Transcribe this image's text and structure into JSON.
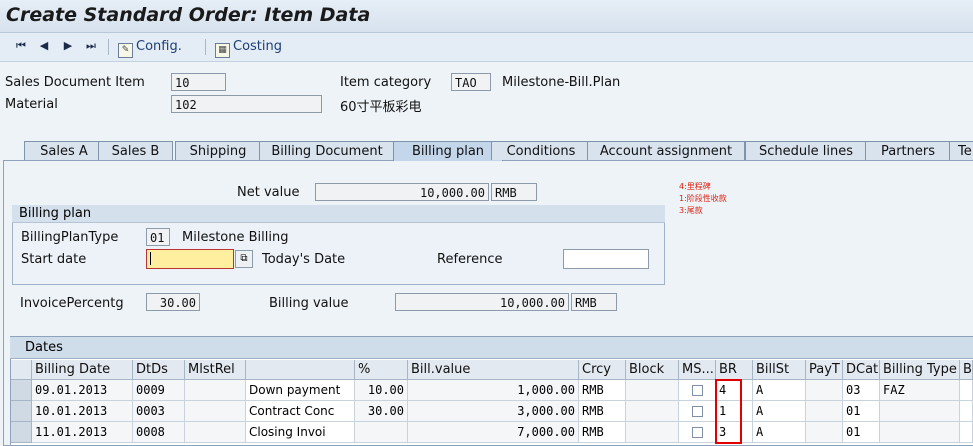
{
  "window": {
    "title": "Create Standard Order: Item Data"
  },
  "toolbar": {
    "config_label": "Config.",
    "costing_label": "Costing"
  },
  "header": {
    "sales_doc_item_label": "Sales Document Item",
    "sales_doc_item_value": "10",
    "item_category_label": "Item category",
    "item_category_value": "TAO",
    "item_category_desc": "Milestone-Bill.Plan",
    "material_label": "Material",
    "material_value": "102",
    "material_desc": "60寸平板彩电"
  },
  "tabs": [
    {
      "label": "Sales A"
    },
    {
      "label": "Sales B"
    },
    {
      "label": "Shipping"
    },
    {
      "label": "Billing Document"
    },
    {
      "label": "Billing plan"
    },
    {
      "label": "Conditions"
    },
    {
      "label": "Account assignment"
    },
    {
      "label": "Schedule lines"
    },
    {
      "label": "Partners"
    },
    {
      "label": "Te"
    }
  ],
  "billing": {
    "net_value_label": "Net value",
    "net_value": "10,000.00",
    "net_value_currency": "RMB",
    "group_title": "Billing plan",
    "plan_type_label": "BillingPlanType",
    "plan_type_value": "01",
    "plan_type_desc": "Milestone Billing",
    "start_date_label": "Start date",
    "start_date_value": "",
    "start_date_desc": "Today's Date",
    "reference_label": "Reference",
    "reference_value": "",
    "invoice_pct_label": "InvoicePercentg",
    "invoice_pct_value": "30.00",
    "billing_value_label": "Billing value",
    "billing_value": "10,000.00",
    "billing_value_currency": "RMB"
  },
  "notes": [
    "4:里程碑",
    "1:阶段性收款",
    "3:尾款"
  ],
  "dates_table": {
    "title": "Dates",
    "columns": [
      "Billing Date",
      "DtDs",
      "MlstRel",
      "",
      "%",
      "Bill.value",
      "Crcy",
      "Block",
      "MS...",
      "BR",
      "BillSt",
      "PayT",
      "DCat",
      "Billing Type",
      "B"
    ],
    "rows": [
      {
        "date": "09.01.2013",
        "dtds": "0009",
        "mlstrel": "",
        "desc": "Down payment",
        "pct": "10.00",
        "value": "1,000.00",
        "crcy": "RMB",
        "block": "",
        "br": "4",
        "billst": "A",
        "payt": "",
        "dcat": "03",
        "btype": "FAZ"
      },
      {
        "date": "10.01.2013",
        "dtds": "0003",
        "mlstrel": "",
        "desc": "Contract Conc",
        "pct": "30.00",
        "value": "3,000.00",
        "crcy": "RMB",
        "block": "",
        "br": "1",
        "billst": "A",
        "payt": "",
        "dcat": "01",
        "btype": ""
      },
      {
        "date": "11.01.2013",
        "dtds": "0008",
        "mlstrel": "",
        "desc": "Closing Invoi",
        "pct": "",
        "value": "7,000.00",
        "crcy": "RMB",
        "block": "",
        "br": "3",
        "billst": "A",
        "payt": "",
        "dcat": "01",
        "btype": ""
      }
    ]
  },
  "colors": {
    "highlight_box": "#e00000",
    "note_text": "#d21111",
    "input_focus": "#ffef9e"
  }
}
